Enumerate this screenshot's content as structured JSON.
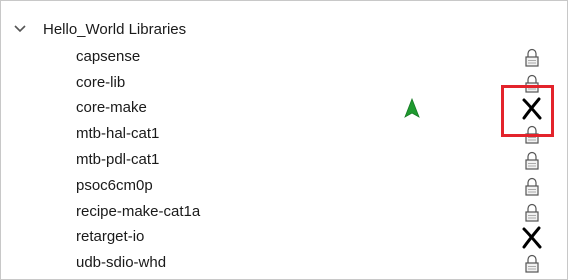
{
  "tree": {
    "group": {
      "label": "Hello_World Libraries",
      "expanded": true,
      "icon": "chevron-down-icon"
    },
    "items": [
      {
        "label": "capsense",
        "status": "locked"
      },
      {
        "label": "core-lib",
        "status": "locked"
      },
      {
        "label": "core-make",
        "status": "unlocked"
      },
      {
        "label": "mtb-hal-cat1",
        "status": "locked"
      },
      {
        "label": "mtb-pdl-cat1",
        "status": "locked"
      },
      {
        "label": "psoc6cm0p",
        "status": "locked"
      },
      {
        "label": "recipe-make-cat1a",
        "status": "locked"
      },
      {
        "label": "retarget-io",
        "status": "unlocked"
      },
      {
        "label": "udb-sdio-whd",
        "status": "locked"
      }
    ]
  },
  "annotation": {
    "highlight_color": "#e3232b",
    "arrow_color": "#1f9a2f"
  }
}
